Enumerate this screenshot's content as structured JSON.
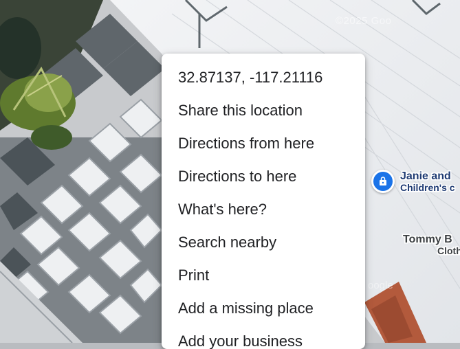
{
  "map": {
    "watermark": "©2025 Goo",
    "watermark_secondary": "oogle",
    "pin_color": "#1a73e8"
  },
  "places": [
    {
      "name_line1": "Janie and",
      "name_line2": "Children's c",
      "icon": "shopping-bag-icon"
    },
    {
      "name_line1": "Tommy B",
      "name_line2": "Cloth"
    }
  ],
  "context_menu": {
    "coordinates": "32.87137, -117.21116",
    "items": [
      "Share this location",
      "Directions from here",
      "Directions to here",
      "What's here?",
      "Search nearby",
      "Print",
      "Add a missing place",
      "Add your business"
    ]
  }
}
